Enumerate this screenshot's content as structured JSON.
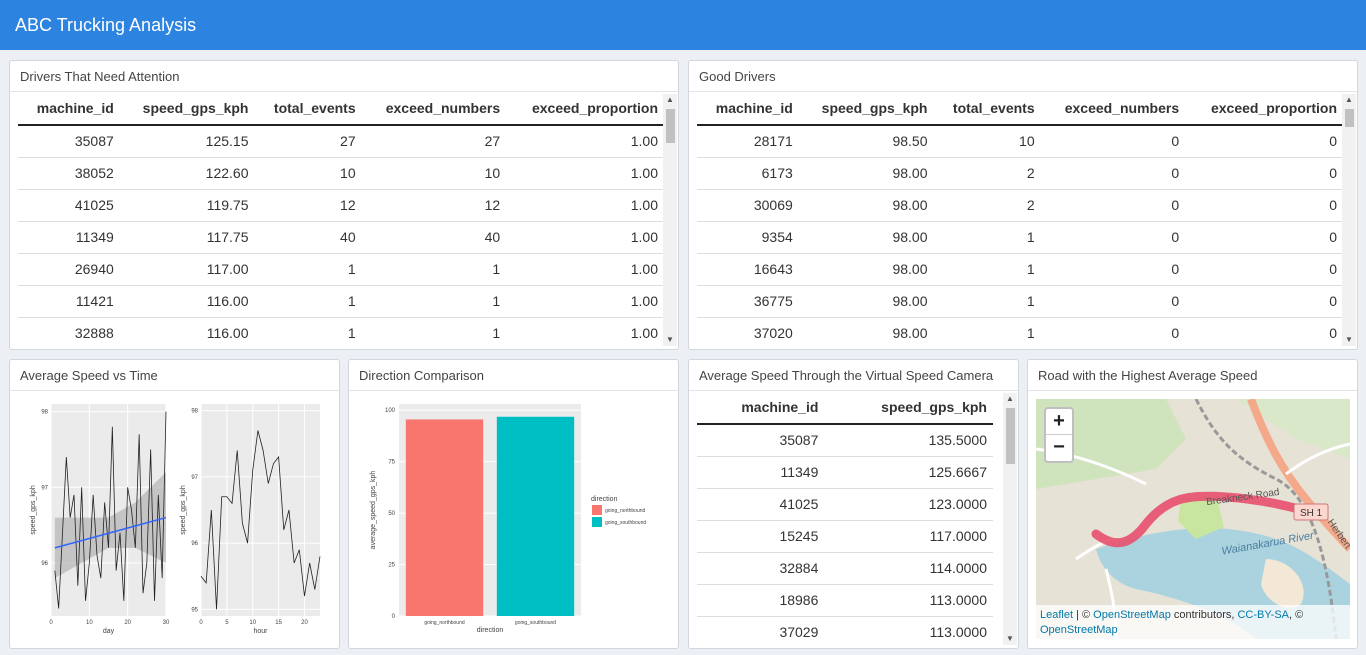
{
  "app_title": "ABC Trucking Analysis",
  "panels": {
    "attention_title": "Drivers That Need Attention",
    "good_title": "Good Drivers",
    "avg_time_title": "Average Speed vs Time",
    "direction_title": "Direction Comparison",
    "camera_title": "Average Speed Through the Virtual Speed Camera",
    "road_title": "Road with the Highest Average Speed"
  },
  "attention_table": {
    "columns": [
      "machine_id",
      "speed_gps_kph",
      "total_events",
      "exceed_numbers",
      "exceed_proportion"
    ],
    "rows": [
      [
        "35087",
        "125.15",
        "27",
        "27",
        "1.00"
      ],
      [
        "38052",
        "122.60",
        "10",
        "10",
        "1.00"
      ],
      [
        "41025",
        "119.75",
        "12",
        "12",
        "1.00"
      ],
      [
        "11349",
        "117.75",
        "40",
        "40",
        "1.00"
      ],
      [
        "26940",
        "117.00",
        "1",
        "1",
        "1.00"
      ],
      [
        "11421",
        "116.00",
        "1",
        "1",
        "1.00"
      ],
      [
        "32888",
        "116.00",
        "1",
        "1",
        "1.00"
      ]
    ]
  },
  "good_table": {
    "columns": [
      "machine_id",
      "speed_gps_kph",
      "total_events",
      "exceed_numbers",
      "exceed_proportion"
    ],
    "rows": [
      [
        "28171",
        "98.50",
        "10",
        "0",
        "0"
      ],
      [
        "6173",
        "98.00",
        "2",
        "0",
        "0"
      ],
      [
        "30069",
        "98.00",
        "2",
        "0",
        "0"
      ],
      [
        "9354",
        "98.00",
        "1",
        "0",
        "0"
      ],
      [
        "16643",
        "98.00",
        "1",
        "0",
        "0"
      ],
      [
        "36775",
        "98.00",
        "1",
        "0",
        "0"
      ],
      [
        "37020",
        "98.00",
        "1",
        "0",
        "0"
      ]
    ]
  },
  "camera_table": {
    "columns": [
      "machine_id",
      "speed_gps_kph"
    ],
    "rows": [
      [
        "35087",
        "135.5000"
      ],
      [
        "11349",
        "125.6667"
      ],
      [
        "41025",
        "123.0000"
      ],
      [
        "15245",
        "117.0000"
      ],
      [
        "32884",
        "114.0000"
      ],
      [
        "18986",
        "113.0000"
      ],
      [
        "37029",
        "113.0000"
      ]
    ]
  },
  "chart_data": [
    {
      "type": "line",
      "xlabel": "day",
      "ylabel": "speed_gps_kph",
      "xticks": [
        0,
        10,
        20,
        30
      ],
      "yticks": [
        95,
        96,
        97,
        98
      ],
      "xlim": [
        0,
        30
      ],
      "ylim": [
        95.3,
        98.1
      ],
      "x": [
        1,
        2,
        3,
        4,
        5,
        6,
        7,
        8,
        9,
        10,
        11,
        12,
        13,
        14,
        15,
        16,
        17,
        18,
        19,
        20,
        21,
        22,
        23,
        24,
        25,
        26,
        27,
        28,
        29,
        30
      ],
      "y": [
        95.9,
        95.4,
        96.4,
        97.4,
        96.6,
        96.9,
        95.7,
        97.0,
        95.5,
        96.0,
        96.9,
        96.1,
        95.8,
        96.8,
        96.2,
        97.8,
        95.9,
        96.4,
        95.5,
        97.0,
        96.7,
        96.2,
        97.7,
        95.6,
        96.0,
        97.5,
        95.5,
        96.9,
        95.8,
        98.0
      ],
      "trend": {
        "x": [
          1,
          30
        ],
        "y": [
          96.2,
          96.6
        ]
      },
      "band": {
        "x": [
          1,
          8,
          15,
          22,
          30
        ],
        "lo": [
          95.8,
          96.0,
          96.2,
          96.2,
          96.0
        ],
        "hi": [
          96.6,
          96.6,
          96.6,
          96.8,
          97.2
        ]
      },
      "colors": {
        "line": "#222222",
        "trend": "#3366ff",
        "band": "#b3b3b3",
        "grid": "#ffffff",
        "bg": "#ebebeb"
      }
    },
    {
      "type": "line",
      "xlabel": "hour",
      "ylabel": "speed_gps_kph",
      "xticks": [
        0,
        5,
        10,
        15,
        20
      ],
      "yticks": [
        95,
        96,
        97,
        98
      ],
      "xlim": [
        0,
        23
      ],
      "ylim": [
        94.9,
        98.1
      ],
      "x": [
        0,
        1,
        2,
        3,
        4,
        5,
        6,
        7,
        8,
        9,
        10,
        11,
        12,
        13,
        14,
        15,
        16,
        17,
        18,
        19,
        20,
        21,
        22,
        23
      ],
      "y": [
        95.5,
        95.4,
        96.5,
        95.0,
        96.7,
        96.7,
        96.6,
        97.4,
        96.3,
        96.0,
        97.1,
        97.7,
        97.4,
        96.9,
        97.2,
        97.3,
        96.2,
        96.5,
        95.7,
        95.9,
        95.2,
        95.7,
        95.3,
        95.8
      ],
      "colors": {
        "line": "#222222",
        "grid": "#ffffff",
        "bg": "#ebebeb"
      }
    },
    {
      "type": "bar",
      "categories": [
        "going_northbound",
        "going_southbound"
      ],
      "values": [
        95.5,
        96.8
      ],
      "xlabel": "direction",
      "ylabel": "average_speed_gps_kph",
      "yticks": [
        0,
        25,
        50,
        75,
        100
      ],
      "ylim": [
        0,
        103
      ],
      "legend_title": "direction",
      "legend_position": "right",
      "colors": [
        "#f8766d",
        "#00bfc4"
      ]
    }
  ],
  "map": {
    "zoom_in": "+",
    "zoom_out": "−",
    "road_label": "Breakneck Road",
    "highway_shield": "SH 1",
    "road_label_2": "Herbert - H",
    "river_label": "Waianakarua River",
    "attribution": {
      "leaflet": "Leaflet",
      "sep1": " | © ",
      "osm": "OpenStreetMap",
      "contributors": " contributors, ",
      "license": "CC-BY-SA",
      "sep2": ", © ",
      "osm2": "OpenStreetMap"
    },
    "colors": {
      "route": "#e8506e",
      "water": "#aad3df",
      "land": "#e6e2d5",
      "park": "#c8e6a0",
      "motorway": "#f3a98a"
    }
  }
}
